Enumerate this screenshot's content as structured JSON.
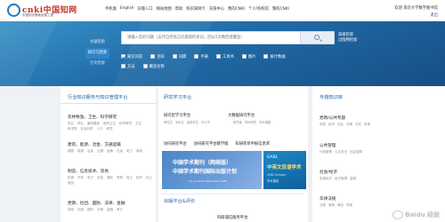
{
  "header": {
    "logo_text": "cnki中国知网",
    "logo_sub": "中国知识基础设施工程",
    "nav": [
      "手机版",
      "English",
      "旧版入口",
      "网站地图",
      "帮助",
      "购买知网卡",
      "充值中心",
      "我的CNKI",
      "个人/机构馆",
      "我的CNKI"
    ],
    "user_info": "欢迎 南京大学数字图书馆",
    "login_label": "退出"
  },
  "hero": {
    "tabs": [
      "文献检索",
      "知识元检索",
      "引文检索"
    ],
    "active_tab": 1,
    "search_placeholder": "请输入您的问题（支持自然语言问题或检索词，回以5次数回增量显）",
    "advanced": [
      "高级检索",
      "出版物检索"
    ],
    "scopes_row1": [
      "知识问答",
      "百科",
      "词典",
      "手册",
      "工具书",
      "图片",
      "统计数据"
    ],
    "scopes_row2": [
      "方法",
      "概念名称"
    ],
    "checked_scope": "知识问答"
  },
  "left_panel": {
    "title": "行业知识服务与知识管理平台",
    "categories": [
      {
        "title": "农林牧渔、卫生、科学研究",
        "subs": [
          "农业",
          "林业",
          "畜牧兽医",
          "医药卫生",
          "科学研究",
          "卫生",
          "科学院",
          "社会科学",
          "人口",
          "研究"
        ]
      },
      {
        "title": "建筑、能源、冶金、交通运输",
        "subs": [
          "建筑",
          "能源",
          "冶金",
          "交通",
          "运输",
          "石油",
          "电力",
          "煤炭"
        ]
      },
      {
        "title": "制造、信息技术、贸易",
        "subs": [
          "机械",
          "汽车",
          "电子",
          "信息",
          "通信",
          "贸易",
          "轻工",
          "纺织",
          "化工",
          "食品"
        ]
      },
      {
        "title": "党政、社团、国防、法律、金融",
        "subs": [
          "党政",
          "社团",
          "国防",
          "法律",
          "金融",
          "审计"
        ]
      }
    ]
  },
  "mid_panel": {
    "title": "研究学习平台",
    "row1": [
      "研究型学习平台",
      "大数据研究平台"
    ],
    "row1_subs_left": [
      "研究生",
      "本科生",
      "高职学生",
      "中小学"
    ],
    "row1_subs_right": [
      "研究者",
      "学科研究",
      "学科课题"
    ],
    "row2": [
      "协同研究平台",
      "协同研究平台教学版",
      "科研项目申报信息库"
    ],
    "banner1_line1": "中国学术期刊（网络版）",
    "banner1_line2": "中国学术期刊国际出版计划",
    "banner1_line3": "CA 11-5555  ISSN 2096-4188",
    "banner2_line1": "GABL",
    "banner2_line2": "中英文双语学术",
    "banner2_line3": "CNKI Scholar",
    "banner2_line4": "学术搜索",
    "section2_title": "出版平台&评价",
    "section2_row": [
      "",
      "科研诚信服务平台"
    ]
  },
  "right_panel": {
    "title": "专题知识库",
    "items": [
      {
        "title": "党政/公共专题",
        "subs": [
          "党政",
          "经济",
          "社会",
          "法律",
          "文化",
          "军事"
        ]
      },
      {
        "title": "公共管理",
        "subs": [
          "行政管理",
          "公共安全",
          "社会保障"
        ]
      },
      {
        "title": "社会/经济",
        "subs": [
          "宏观经济",
          "经济管理",
          "金融"
        ]
      },
      {
        "title": "华律法规",
        "subs": [
          "法规",
          "案例",
          "律法",
          "学案"
        ]
      }
    ]
  },
  "watermark": {
    "text": "Baidu 经验"
  },
  "colors": {
    "accent": "#1f5fa8",
    "hero": "#1f6aa6",
    "brand_red": "#c0392b"
  }
}
